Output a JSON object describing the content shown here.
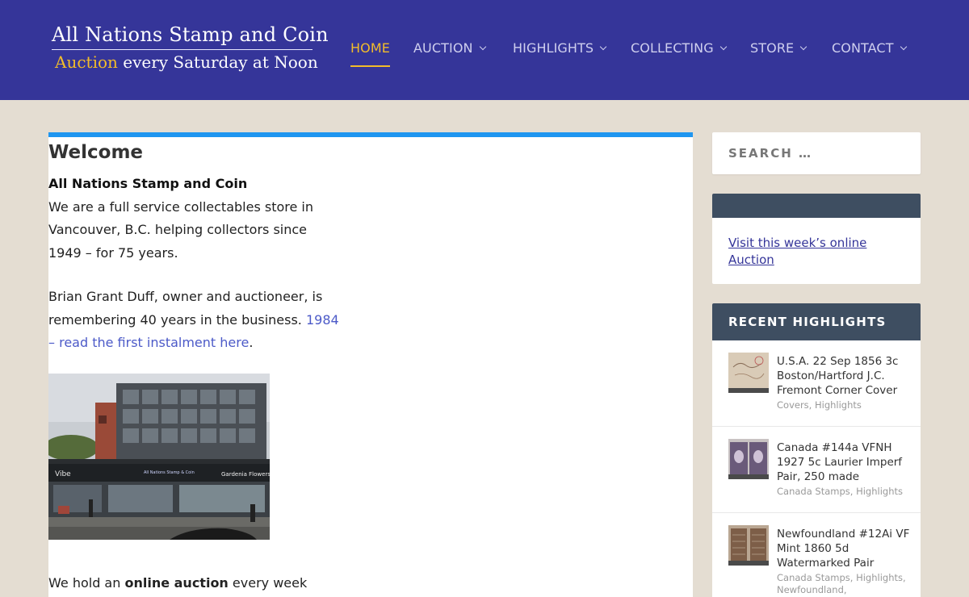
{
  "site": {
    "title": "All Nations Stamp and Coin",
    "tagline_accent": "Auction",
    "tagline_rest": " every Saturday at Noon"
  },
  "nav": {
    "items": [
      {
        "label": "HOME",
        "active": true
      },
      {
        "label": "AUCTION"
      },
      {
        "label": "HIGHLIGHTS"
      },
      {
        "label": "COLLECTING"
      },
      {
        "label": "STORE"
      },
      {
        "label": "CONTACT"
      }
    ]
  },
  "main": {
    "title": "Welcome",
    "intro_heading": "All Nations Stamp and Coin",
    "intro_text": "We are a full service collectables store in Vancouver, B.C. helping collectors since 1949 – for 75 years.",
    "owner_text": "Brian Grant Duff, owner and auctioneer, is remembering 40 years in the business. ",
    "owner_link": "1984 – read the first instalment here",
    "owner_end": ".",
    "photo_signs": [
      "Vibe",
      "All Nations Stamp & Coin",
      "Gardenia Flowers"
    ],
    "bottom_pre": "We hold an ",
    "bottom_bold": "online auction",
    "bottom_post": " every week"
  },
  "sidebar": {
    "search_placeholder": "SEARCH …",
    "auction_link": "Visit this week’s online Auction",
    "recent_title": "RECENT HIGHLIGHTS",
    "posts": [
      {
        "title": "U.S.A. 22 Sep 1856 3c Boston/Hartford J.C. Fremont Corner Cover",
        "cats": "Covers, Highlights",
        "thumb": "cover"
      },
      {
        "title": "Canada #144a VFNH 1927 5c Laurier Imperf Pair, 250 made",
        "cats": "Canada Stamps, Highlights",
        "thumb": "stamp-pair-purple"
      },
      {
        "title": "Newfoundland #12Ai VF Mint 1860 5d Watermarked Pair",
        "cats": "Canada Stamps, Highlights, Newfoundland,",
        "thumb": "stamp-pair-brown"
      }
    ]
  },
  "colors": {
    "header": "#353599",
    "accent": "#f2bc2a",
    "card_top": "#1f96f0",
    "widget_bar": "#3e4e61",
    "background": "#e4ddd2"
  }
}
